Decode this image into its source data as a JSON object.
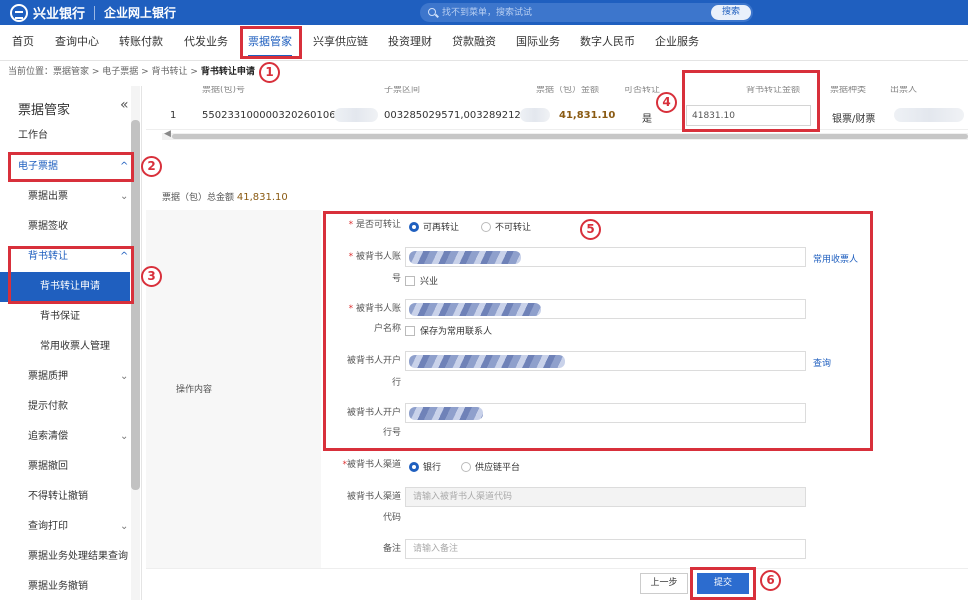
{
  "header": {
    "bank_name": "兴业银行",
    "portal_name": "企业网上银行",
    "search_placeholder": "找不到菜单，搜索试试",
    "search_button": "搜索"
  },
  "nav": {
    "items": [
      {
        "label": "首页"
      },
      {
        "label": "查询中心"
      },
      {
        "label": "转账付款"
      },
      {
        "label": "代发业务"
      },
      {
        "label": "票据管家"
      },
      {
        "label": "兴享供应链"
      },
      {
        "label": "投资理财"
      },
      {
        "label": "贷款融资"
      },
      {
        "label": "国际业务"
      },
      {
        "label": "数字人民币"
      },
      {
        "label": "企业服务"
      }
    ],
    "active": "票据管家"
  },
  "breadcrumb": {
    "prefix": "当前位置：",
    "path": "票据管家 > 电子票据 > 背书转让 > ",
    "current": "背书转让申请"
  },
  "sidebar": {
    "title": "票据管家",
    "collapse_icon": "«",
    "items": [
      {
        "label": "工作台"
      },
      {
        "label": "电子票据"
      },
      {
        "label": "票据出票"
      },
      {
        "label": "票据签收"
      },
      {
        "label": "背书转让"
      },
      {
        "label": "背书转让申请"
      },
      {
        "label": "背书保证"
      },
      {
        "label": "常用收票人管理"
      },
      {
        "label": "票据质押"
      },
      {
        "label": "提示付款"
      },
      {
        "label": "追索清偿"
      },
      {
        "label": "票据撤回"
      },
      {
        "label": "不得转让撤销"
      },
      {
        "label": "查询打印"
      },
      {
        "label": "票据业务处理结果查询"
      },
      {
        "label": "票据业务撤销"
      }
    ],
    "chevron_down": "⌄",
    "chevron_up": "^"
  },
  "table": {
    "headers": [
      "票据(包)号",
      "子票区间",
      "票据（包）金额",
      "可否转让",
      "背书转让金额",
      "票据种类",
      "出票人"
    ],
    "rows": [
      {
        "index": "1",
        "bill_no": "5502331000003202601061​0",
        "sub_range": "003285029571,003289212680",
        "amount": "41,831.10",
        "transferable": "是",
        "endorse_amount": "41831.10",
        "bill_type": "银票/财票"
      }
    ],
    "scroll_left": "◀"
  },
  "total": {
    "label": "票据（包）总金额 ",
    "amount": "41,831.10"
  },
  "form": {
    "section_label": "操作内容",
    "transferable": {
      "label": "是否可转让",
      "option_yes": "可再转让",
      "option_no": "不可转让"
    },
    "endorsee_account": {
      "label_line1": "被背书人账",
      "label_line2": "号",
      "checkbox": "兴业",
      "link": "常用收票人"
    },
    "endorsee_name": {
      "label_line1": "被背书人账",
      "label_line2": "户名称",
      "checkbox": "保存为常用联系人"
    },
    "endorsee_bank": {
      "label_line1": "被背书人开户",
      "label_line2": "行",
      "link": "查询"
    },
    "endorsee_bank_no": {
      "label_line1": "被背书人开户",
      "label_line2": "行号"
    },
    "channel": {
      "label": "被背书人渠道",
      "option_bank": "银行",
      "option_supply": "供应链平台"
    },
    "channel_code": {
      "label_line1": "被背书人渠道",
      "label_line2": "代码",
      "placeholder": "请输入被背书人渠道代码"
    },
    "remark": {
      "label": "备注",
      "placeholder": "请输入备注"
    },
    "required_mark": "*"
  },
  "footer": {
    "prev_button": "上一步",
    "submit_button": "提交"
  },
  "annotations": [
    "1",
    "2",
    "3",
    "4",
    "5",
    "6"
  ],
  "colors": {
    "brand_blue": "#1f5fbf",
    "highlight_red": "#d8303b",
    "amount_brown": "#8a5a12"
  }
}
